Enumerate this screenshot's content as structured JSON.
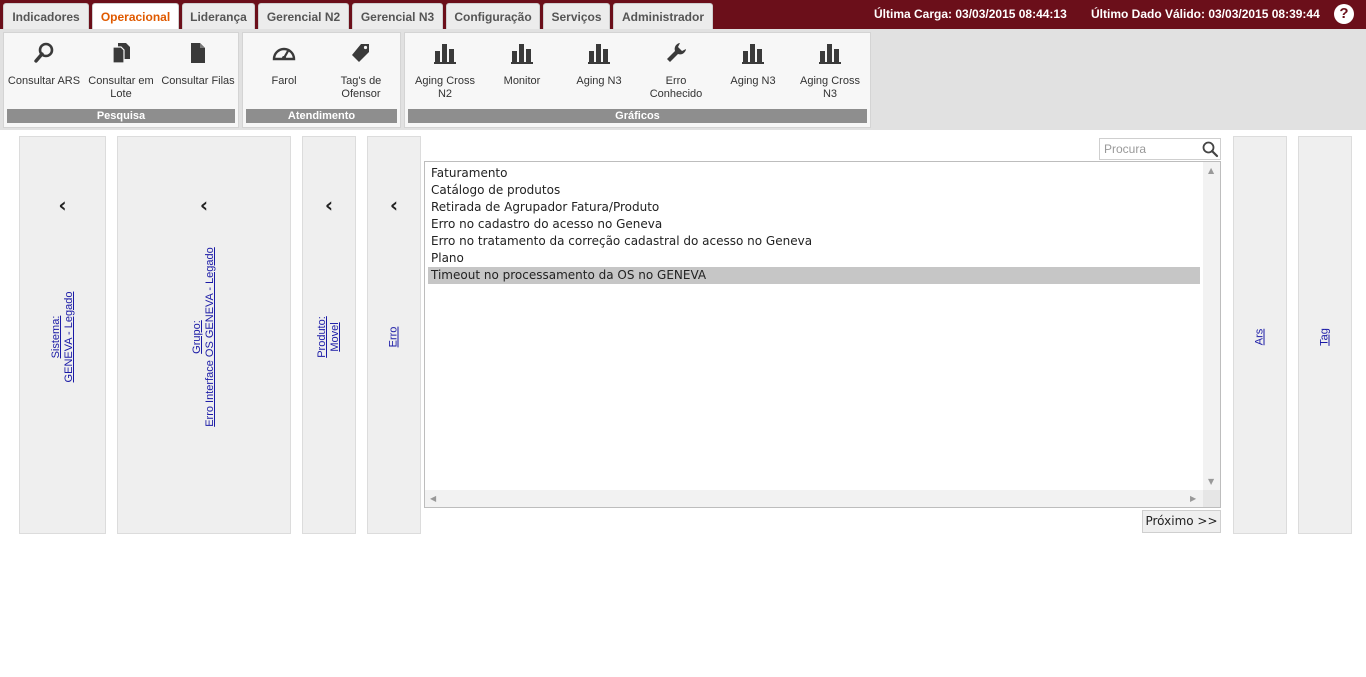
{
  "tabs": [
    {
      "label": "Indicadores",
      "active": false
    },
    {
      "label": "Operacional",
      "active": true
    },
    {
      "label": "Liderança",
      "active": false
    },
    {
      "label": "Gerencial N2",
      "active": false
    },
    {
      "label": "Gerencial N3",
      "active": false
    },
    {
      "label": "Configuração",
      "active": false
    },
    {
      "label": "Serviços",
      "active": false
    },
    {
      "label": "Administrador",
      "active": false
    }
  ],
  "status": {
    "ultima_carga": "Última Carga: 03/03/2015 08:44:13",
    "ultimo_dado": "Último Dado Válido: 03/03/2015 08:39:44"
  },
  "ribbon": {
    "pesquisa": {
      "label": "Pesquisa",
      "buttons": [
        {
          "label": "Consultar ARS",
          "icon": "magnifier-icon"
        },
        {
          "label": "Consultar em Lote",
          "icon": "documents-icon"
        },
        {
          "label": "Consultar Filas",
          "icon": "document-icon"
        }
      ]
    },
    "atendimento": {
      "label": "Atendimento",
      "buttons": [
        {
          "label": "Farol",
          "icon": "gauge-icon"
        },
        {
          "label": "Tag's de Ofensor",
          "icon": "tag-icon"
        }
      ]
    },
    "graficos": {
      "label": "Gráficos",
      "buttons": [
        {
          "label": "Aging Cross N2",
          "icon": "bar-chart-icon"
        },
        {
          "label": "Monitor",
          "icon": "bar-chart-icon"
        },
        {
          "label": "Aging N3",
          "icon": "bar-chart-icon"
        },
        {
          "label": "Erro Conhecido",
          "icon": "wrench-icon"
        },
        {
          "label": "Aging N3",
          "icon": "bar-chart-icon"
        },
        {
          "label": "Aging Cross N3",
          "icon": "bar-chart-icon"
        }
      ]
    }
  },
  "filters": {
    "sistema": {
      "title": "Sistema:",
      "value": "GENEVA - Legado"
    },
    "grupo": {
      "title": "Grupo:",
      "value": "Erro Interface OS GENEVA - Legado"
    },
    "produto": {
      "title": "Produto:",
      "value": "Movel"
    },
    "erro": {
      "title": "Erro"
    },
    "ars": {
      "title": "Ars"
    },
    "tag": {
      "title": "Tag"
    }
  },
  "search": {
    "placeholder": "Procura"
  },
  "list": {
    "items": [
      "Faturamento",
      "Catálogo de produtos",
      "Retirada de Agrupador Fatura/Produto",
      "Erro no cadastro do acesso no Geneva",
      "Erro no tratamento da correção cadastral do acesso no Geneva",
      "Plano",
      "Timeout no processamento da OS no GENEVA"
    ],
    "selected_index": 6
  },
  "next_label": "Próximo >>",
  "colors": {
    "topbar": "#6b0f1a",
    "active_tab_text": "#e05a00",
    "link": "#1a1aa6"
  }
}
